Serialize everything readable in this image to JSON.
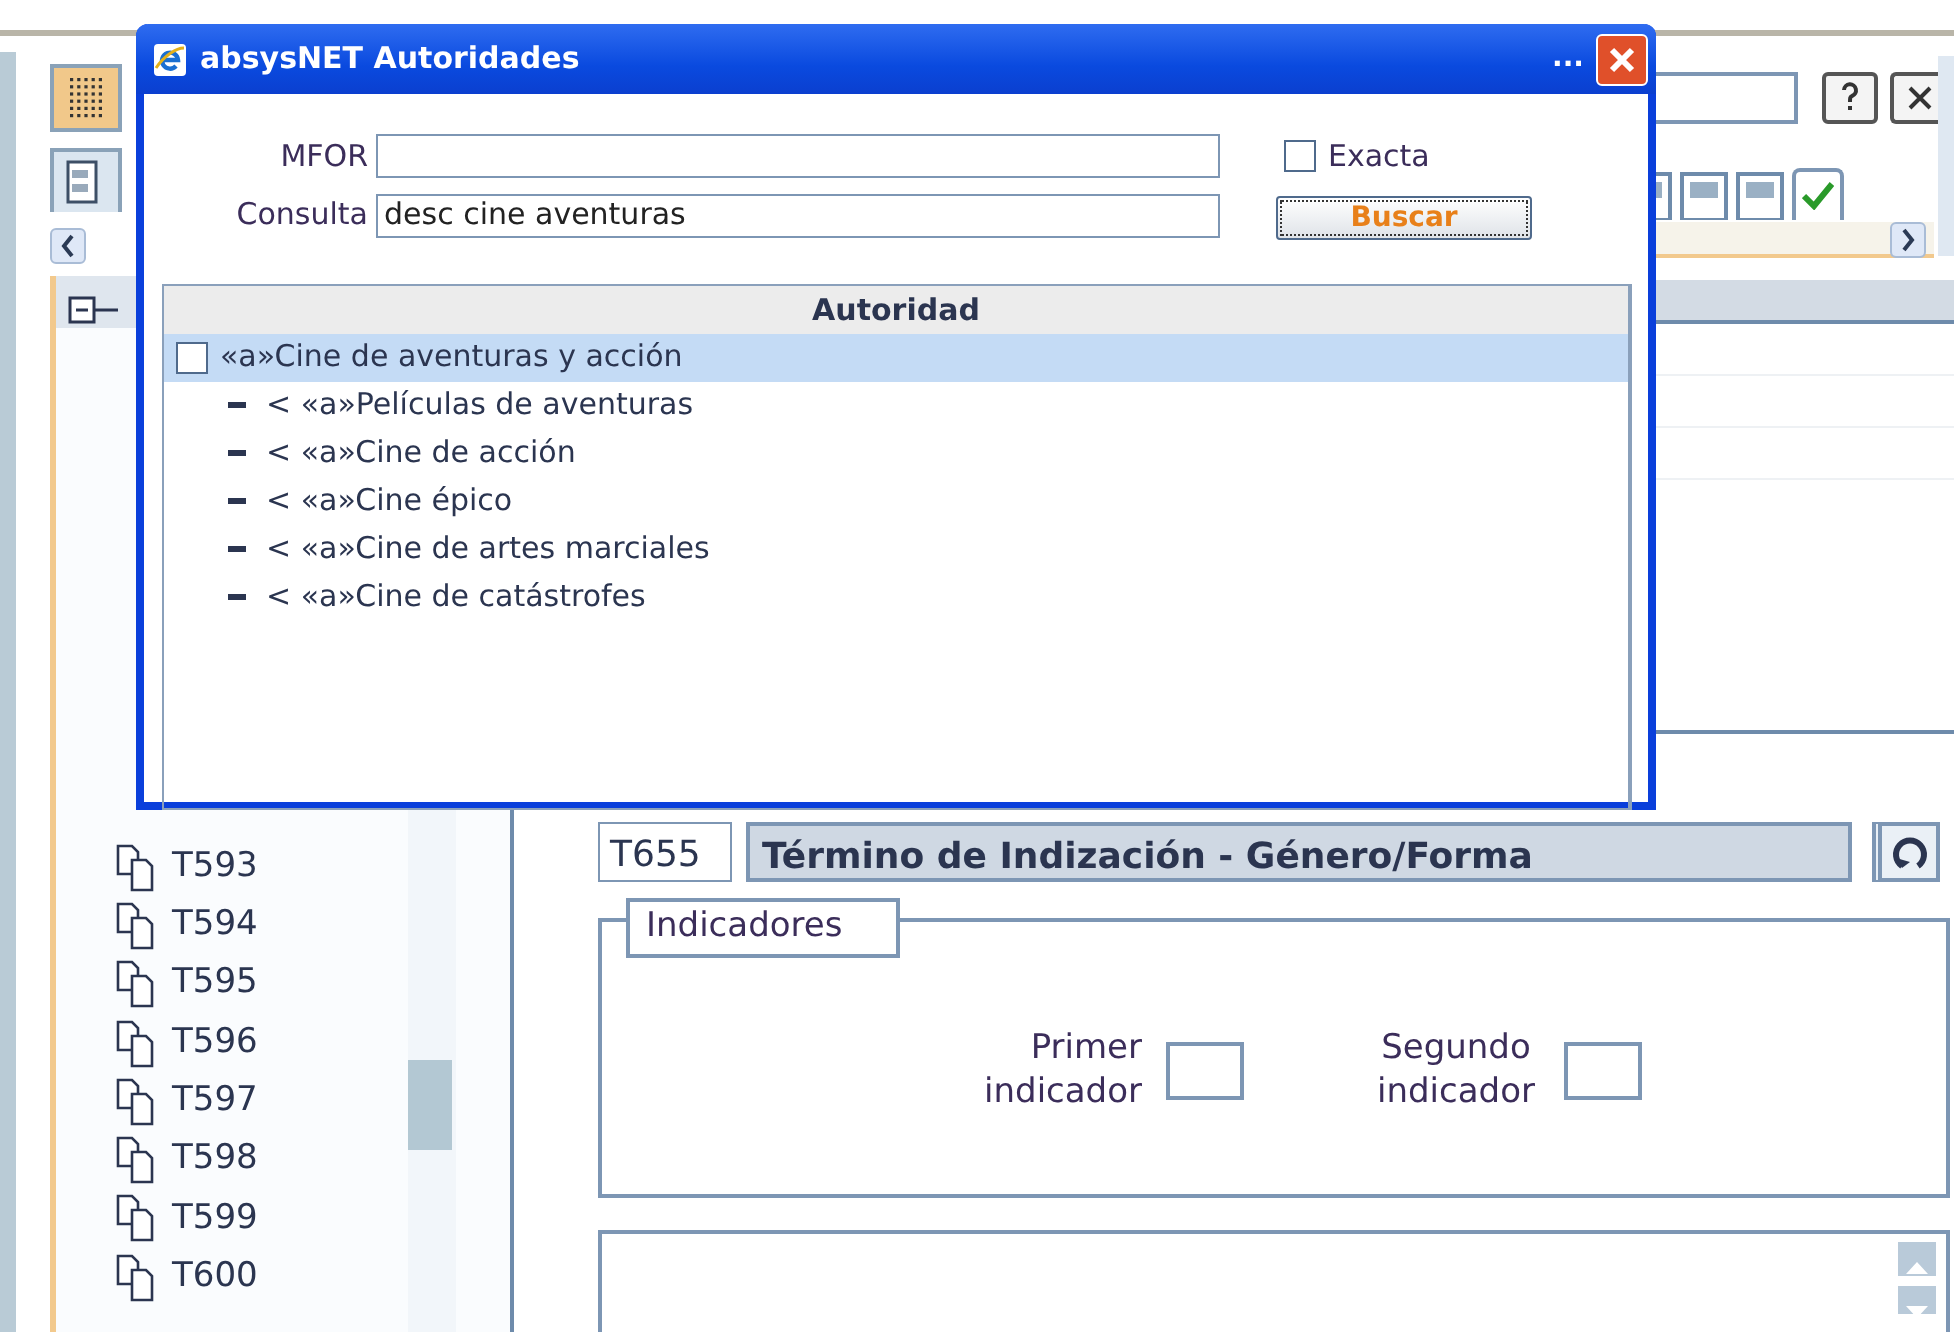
{
  "app": {
    "tree": {
      "items": [
        {
          "label": "T593"
        },
        {
          "label": "T594"
        },
        {
          "label": "T595"
        },
        {
          "label": "T596"
        },
        {
          "label": "T597"
        },
        {
          "label": "T598"
        },
        {
          "label": "T599"
        },
        {
          "label": "T600"
        }
      ]
    },
    "field": {
      "tag": "T655",
      "title": "Término de Indización - Género/Forma"
    },
    "indicators": {
      "legend": "Indicadores",
      "fields": [
        {
          "label": "Primer indicador"
        },
        {
          "label": "Segundo indicador"
        }
      ]
    }
  },
  "dialog": {
    "title": "absysNET Autoridades",
    "ellipsis": "...",
    "fields": [
      {
        "label": "MFOR"
      },
      {
        "label": "Consulta",
        "value": "desc cine aventuras"
      }
    ],
    "exact": {
      "label": "Exacta",
      "checked": false
    },
    "search_button": "Buscar",
    "results": {
      "column": "Autoridad",
      "rows": [
        {
          "text": "«a»Cine de aventuras y acción",
          "selected": true,
          "checked": false,
          "children": [
            {
              "text": "< «a»Películas de aventuras",
              "selected": false
            },
            {
              "text": "< «a»Cine de acción",
              "selected": false
            },
            {
              "text": "< «a»Cine épico",
              "selected": false
            },
            {
              "text": "< «a»Cine de artes marciales",
              "selected": false
            },
            {
              "text": "< «a»Cine de catástrofes",
              "selected": false
            }
          ]
        }
      ]
    }
  }
}
